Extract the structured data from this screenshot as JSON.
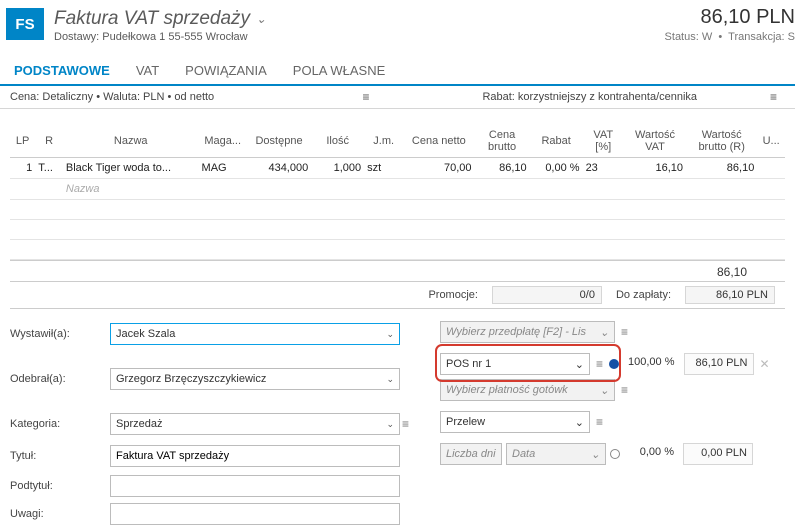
{
  "header": {
    "badge": "FS",
    "title": "Faktura VAT sprzedaży",
    "subtitle": "Dostawy: Pudełkowa 1 55-555 Wrocław",
    "total": "86,10 PLN",
    "status_label": "Status:",
    "status_value": "W",
    "trans_label": "Transakcja:",
    "trans_value": "S"
  },
  "tabs": {
    "podstawowe": "PODSTAWOWE",
    "vat": "VAT",
    "powiazania": "POWIĄZANIA",
    "pola_wlasne": "POLA WŁASNE"
  },
  "summary": {
    "left": "Cena: Detaliczny • Waluta: PLN • od netto",
    "right": "Rabat: korzystniejszy z kontrahenta/cennika"
  },
  "columns": {
    "lp": "LP",
    "r": "R",
    "nazwa": "Nazwa",
    "maga": "Maga...",
    "dostepne": "Dostępne",
    "ilosc": "Ilość",
    "jm": "J.m.",
    "cena_netto": "Cena netto",
    "cena_brutto": "Cena brutto",
    "rabat": "Rabat",
    "vat_pct": "VAT [%]",
    "wartosc_vat": "Wartość VAT",
    "wartosc_brutto": "Wartość brutto (R)",
    "u": "U..."
  },
  "rows": [
    {
      "lp": "1",
      "r": "T...",
      "nazwa": "Black Tiger woda to...",
      "maga": "MAG",
      "dostepne": "434,000",
      "ilosc": "1,000",
      "jm": "szt",
      "cena_netto": "70,00",
      "cena_brutto": "86,10",
      "rabat": "0,00 %",
      "vat_pct": "23",
      "wartosc_vat": "16,10",
      "wartosc_brutto": "86,10"
    }
  ],
  "blank_hint": "Nazwa",
  "totals": {
    "sum": "86,10"
  },
  "promo": {
    "label": "Promocje:",
    "value": "0/0",
    "pay_label": "Do zapłaty:",
    "pay_value": "86,10 PLN"
  },
  "form": {
    "wystawil_label": "Wystawił(a):",
    "wystawil": "Jacek Szala",
    "odebral_label": "Odebrał(a):",
    "odebral": "Grzegorz Brzęczyszczykiewicz",
    "kategoria_label": "Kategoria:",
    "kategoria": "Sprzedaż",
    "tytul_label": "Tytuł:",
    "tytul": "Faktura VAT sprzedaży",
    "podtytul_label": "Podtytuł:",
    "podtytul": "",
    "uwagi_label": "Uwagi:",
    "uwagi": ""
  },
  "payments": {
    "prepay_placeholder": "Wybierz przedpłatę [F2] - Lis",
    "pos": "POS nr 1",
    "pos_pct": "100,00 %",
    "pos_amount": "86,10 PLN",
    "cash_placeholder": "Wybierz płatność gotówk",
    "transfer": "Przelew",
    "days_placeholder": "Liczba dni",
    "date_placeholder": "Data",
    "transfer_pct": "0,00 %",
    "transfer_amount": "0,00 PLN"
  }
}
